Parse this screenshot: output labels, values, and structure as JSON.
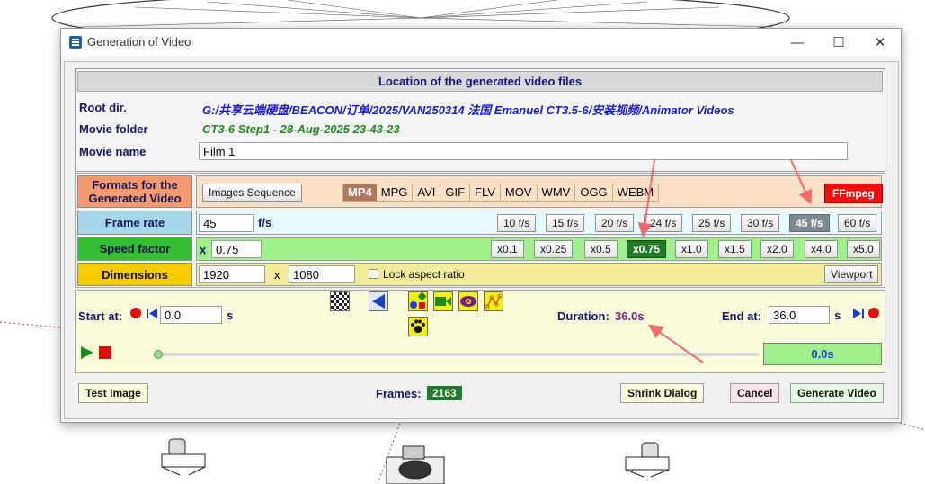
{
  "window": {
    "title": "Generation of Video",
    "controls": {
      "minimize": "—",
      "maximize": "☐",
      "close": "✕"
    }
  },
  "location": {
    "header": "Location of the generated video files",
    "root_label": "Root dir.",
    "root_value": "G:/共享云端硬盘/BEACON/订单/2025/VAN250314 法国 Emanuel CT3.5-6/安装视频/Animator Videos",
    "folder_label": "Movie folder",
    "folder_value": "CT3-6 Step1 - 28-Aug-2025 23-43-23",
    "name_label": "Movie name",
    "name_value": "Film 1"
  },
  "formats": {
    "label": "Formats for the Generated Video",
    "images_sequence": "Images Sequence",
    "items": [
      "MP4",
      "MPG",
      "AVI",
      "GIF",
      "FLV",
      "MOV",
      "WMV",
      "OGG",
      "WEBM"
    ],
    "selected": "MP4",
    "ffmpeg": "FFmpeg"
  },
  "frame_rate": {
    "label": "Frame rate",
    "value": "45",
    "unit": "f/s",
    "presets": [
      "10 f/s",
      "15 f/s",
      "20 f/s",
      "24 f/s",
      "25 f/s",
      "30 f/s",
      "45 f/s",
      "60 f/s"
    ],
    "selected": "45 f/s"
  },
  "speed": {
    "label": "Speed factor",
    "prefix": "x",
    "value": "0.75",
    "presets": [
      "x0.1",
      "x0.25",
      "x0.5",
      "x0.75",
      "x1.0",
      "x1.5",
      "x2.0",
      "x4.0",
      "x5.0"
    ],
    "selected": "x0.75"
  },
  "dimensions": {
    "label": "Dimensions",
    "width": "1920",
    "x": "x",
    "height": "1080",
    "lock_label": "Lock aspect ratio",
    "viewport": "Viewport"
  },
  "timeline": {
    "start_label": "Start at:",
    "start_value": "0.0",
    "start_unit": "s",
    "duration_label": "Duration:",
    "duration_value": "36.0s",
    "end_label": "End at:",
    "end_value": "36.0",
    "end_unit": "s",
    "current_time": "0.0s",
    "slider_position": 0
  },
  "footer": {
    "test_image": "Test Image",
    "frames_label": "Frames:",
    "frames_value": "2163",
    "shrink": "Shrink Dialog",
    "cancel": "Cancel",
    "generate": "Generate Video"
  },
  "colors": {
    "format_label_bg": "#f39a71",
    "format_panel_bg": "#fbe0c8",
    "framerate_label_bg": "#a6d6ea",
    "framerate_panel_bg": "#e4fafe",
    "speed_label_bg": "#34be34",
    "speed_panel_bg": "#9ff08c",
    "dimensions_label_bg": "#f5cc00",
    "dimensions_panel_bg": "#f2eb9a",
    "annotation_arrow": "#f06a6a"
  },
  "icons": [
    "checker-icon",
    "back-arrow-icon",
    "shapes-icon",
    "camera-icon",
    "eye-icon",
    "path-icon",
    "paw-icon",
    "play-icon",
    "stop-icon"
  ]
}
